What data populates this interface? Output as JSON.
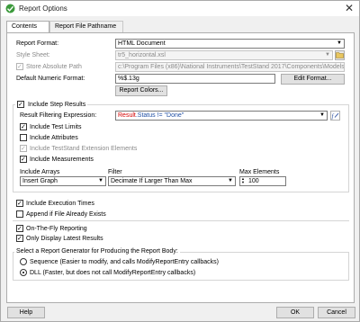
{
  "window": {
    "title": "Report Options",
    "close_label": "✕"
  },
  "tabs": [
    {
      "label": "Contents"
    },
    {
      "label": "Report File Pathname"
    }
  ],
  "report_format": {
    "label": "Report Format:",
    "value": "HTML Document"
  },
  "style_sheet": {
    "label": "Style Sheet:",
    "value": "tr5_horizontal.xsl"
  },
  "store_absolute_path": {
    "label": "Store Absolute Path",
    "value": "c:\\Program Files (x86)\\National Instruments\\TestStand 2017\\Components\\Models\\TestStandI"
  },
  "numeric_format": {
    "label": "Default Numeric Format:",
    "value": "%$.13g",
    "edit_button": "Edit Format..."
  },
  "report_colors_button": "Report Colors...",
  "include_step_results": {
    "label": "Include Step Results",
    "filter_label": "Result Filtering Expression:",
    "filter_expr_keyword": "Result",
    "filter_expr_rest": ".Status != \"Done\"",
    "options": [
      {
        "label": "Include Test Limits",
        "checked": true,
        "disabled": false
      },
      {
        "label": "Include Attributes",
        "checked": false,
        "disabled": false
      },
      {
        "label": "Include TestStand Extension Elements",
        "checked": true,
        "disabled": true
      },
      {
        "label": "Include Measurements",
        "checked": true,
        "disabled": false
      }
    ],
    "arrays_label": "Include Arrays",
    "arrays_value": "Insert Graph",
    "filter_header": "Filter",
    "filter_value": "Decimate If Larger Than Max",
    "max_label": "Max Elements",
    "max_value": "100"
  },
  "general_options": [
    {
      "label": "Include Execution Times",
      "checked": true
    },
    {
      "label": "Append if File Already Exists",
      "checked": false
    }
  ],
  "reporting_options": [
    {
      "label": "On-The-Fly Reporting",
      "checked": true
    },
    {
      "label": "Only Display Latest Results",
      "checked": true
    }
  ],
  "generator": {
    "title": "Select a Report Generator for Producing the Report Body:",
    "options": [
      {
        "label": "Sequence (Easier to modify, and calls ModifyReportEntry callbacks)",
        "selected": false
      },
      {
        "label": "DLL (Faster, but does not call ModifyReportEntry callbacks)",
        "selected": true
      }
    ]
  },
  "buttons": {
    "help": "Help",
    "ok": "OK",
    "cancel": "Cancel"
  }
}
